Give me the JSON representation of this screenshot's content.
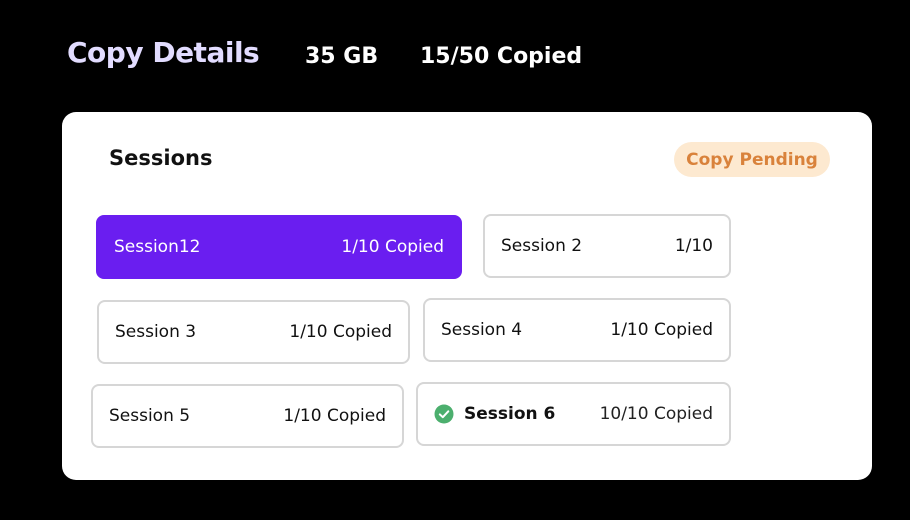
{
  "header": {
    "title": "Copy Details",
    "size": "35 GB",
    "copied": "15/50 Copied"
  },
  "card": {
    "title": "Sessions",
    "status": "Copy Pending"
  },
  "sessions": [
    {
      "name": "Session12",
      "count": "1/10 Copied",
      "active": true
    },
    {
      "name": "Session 2",
      "count": "1/10",
      "active": false
    },
    {
      "name": "Session 3",
      "count": "1/10 Copied",
      "active": false
    },
    {
      "name": "Session 4",
      "count": "1/10 Copied",
      "active": false
    },
    {
      "name": "Session 5",
      "count": "1/10 Copied",
      "active": false
    },
    {
      "name": "Session 6",
      "count": "10/10 Copied",
      "active": false,
      "icon": "check-circle-icon"
    }
  ],
  "colors": {
    "accent": "#6a1ef0",
    "pending_bg": "#fde9d0",
    "pending_text": "#d9823b",
    "success": "#4caf6e"
  }
}
